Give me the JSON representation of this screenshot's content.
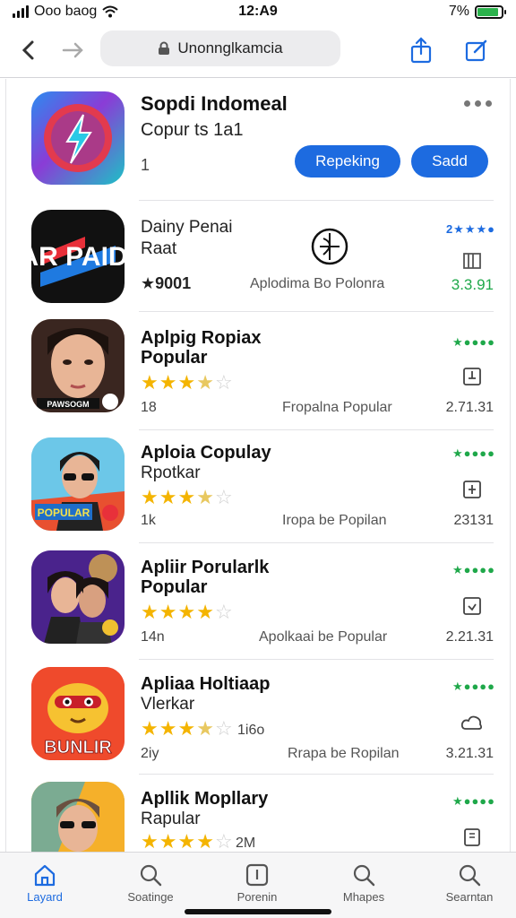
{
  "status_bar": {
    "carrier": "Ooo baog",
    "time": "12:A9",
    "battery_pct": "7%",
    "battery_level": 0.9
  },
  "nav": {
    "url": "Unonnglkamcia"
  },
  "header_app": {
    "title": "Sopdi Indomeal",
    "subtitle": "Copur ts 1a1",
    "count": "1",
    "button_primary": "Repeking",
    "button_secondary": "Sadd"
  },
  "apps": [
    {
      "title": "Dainy Penai",
      "title2": "Raat",
      "rating": "★9001",
      "category": "Aplodima Bo Polonra",
      "dots": "2★★★●",
      "version": "3.3.91",
      "stars": null
    },
    {
      "title": "Aplpig Ropiax",
      "title2": "Popular",
      "rating": "18",
      "category": "Fropalna Popular",
      "dots": "★●●●●",
      "version": "2.71.31",
      "stars": 3.5
    },
    {
      "title": "Aploia Copulay",
      "title2": "Rpotkar",
      "rating": "1k",
      "category": "Iropa be Popilan",
      "dots": "★●●●●",
      "version": "23131",
      "stars": 3.5
    },
    {
      "title": "Apliir Porularlk",
      "title2": "Popular",
      "rating": "14n",
      "category": "Apolkaai be Popular",
      "dots": "★●●●●",
      "version": "2.21.31",
      "stars": 4
    },
    {
      "title": "Apliaa Holtiaap",
      "title2": "Vlerkar",
      "rating": "2iy",
      "category": "Rrapa be Ropilan",
      "dots": "★●●●●",
      "version": "3.21.31",
      "stars": 3.5,
      "stars_label": "1i6o"
    },
    {
      "title": "Apllik Mopllary",
      "title2": "Rapular",
      "rating": "",
      "category": "",
      "dots": "★●●●●",
      "version": "",
      "stars": 4,
      "stars_label": "2M"
    }
  ],
  "icon_labels": {
    "app1_text": "AR PAID!",
    "app2_text": "PAWSOGM",
    "app3_text": "POPULAR",
    "app5_text": "BUNLIR"
  },
  "tabs": [
    {
      "label": "Layard",
      "icon": "home-icon",
      "active": true
    },
    {
      "label": "Soatinge",
      "icon": "search-icon",
      "active": false
    },
    {
      "label": "Porenin",
      "icon": "download-icon",
      "active": false
    },
    {
      "label": "Mhapes",
      "icon": "search-icon",
      "active": false
    },
    {
      "label": "Searntan",
      "icon": "search-icon",
      "active": false
    }
  ],
  "colors": {
    "accent": "#1d6be0",
    "star": "#f4b400",
    "rating_green": "#1fa84a"
  }
}
